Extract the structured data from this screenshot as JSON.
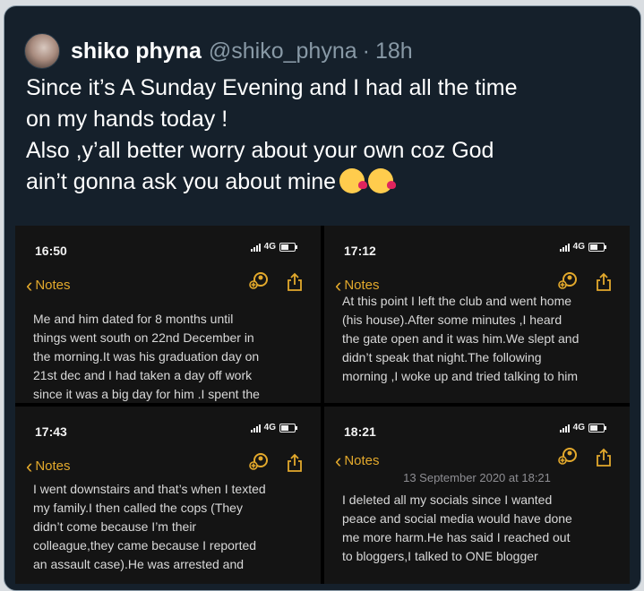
{
  "tweet": {
    "display_name": "shiko phyna",
    "handle": "@shiko_phyna",
    "separator": "·",
    "time": "18h",
    "text": "Since it’s A Sunday Evening and I had all the time\non my hands today !\nAlso ,y’all better worry about your own coz God\nain’t gonna ask you about mine",
    "emojis": [
      "face-blowing-a-kiss-icon",
      "face-blowing-a-kiss-icon"
    ]
  },
  "screenshots": [
    {
      "time": "16:50",
      "network": "4G",
      "back_label": "Notes",
      "note_text": "Me and him dated for 8 months until\nthings went south on 22nd December in\nthe morning.It was his graduation day on\n21st dec and I had taken a day off work\nsince it was a big day for him .I spent the"
    },
    {
      "time": "17:12",
      "network": "4G",
      "back_label": "Notes",
      "note_text": "At this point I left the club and went home\n(his house).After some minutes ,I heard\nthe gate open and it was him.We slept and\ndidn’t speak that night.The following\nmorning ,I woke up and tried talking to him"
    },
    {
      "time": "17:43",
      "network": "4G",
      "back_label": "Notes",
      "note_text": "I went downstairs and that’s when I texted\nmy family.I then called the cops (They\ndidn’t come because I’m their\ncolleague,they came because I reported\nan assault case).He was arrested and"
    },
    {
      "time": "18:21",
      "network": "4G",
      "back_label": "Notes",
      "date_line": "13 September 2020 at 18:21",
      "note_text": "I deleted all my socials since I wanted\npeace and social media would have done\nme more harm.He has said I reached out\nto bloggers,I talked to ONE blogger"
    }
  ],
  "colors": {
    "card_background": "#15202b",
    "notes_accent": "#e3a92c",
    "muted_text": "#8899a6"
  }
}
